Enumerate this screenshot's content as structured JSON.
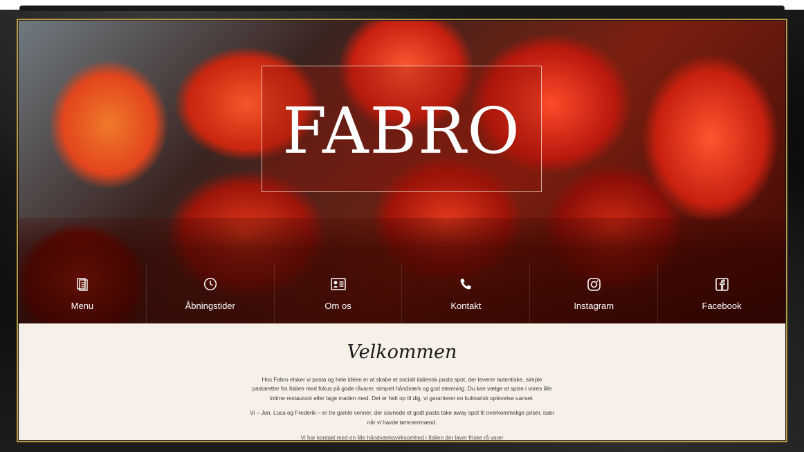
{
  "brand": {
    "name": "FABRO"
  },
  "nav": {
    "items": [
      {
        "label": "Menu",
        "icon": "menu-document-icon"
      },
      {
        "label": "Åbningstider",
        "icon": "clock-icon"
      },
      {
        "label": "Om os",
        "icon": "contact-card-icon"
      },
      {
        "label": "Kontakt",
        "icon": "phone-icon"
      },
      {
        "label": "Instagram",
        "icon": "instagram-icon"
      },
      {
        "label": "Facebook",
        "icon": "facebook-icon"
      }
    ]
  },
  "welcome": {
    "heading": "Velkommen",
    "paragraphs": [
      "Hos Fabro elsker vi pasta og hele idéen er at skabe et socialt italiensk pasta spot, der leverer autentiske, simple pastaretter fra Italien med fokus på gode råvarer, simpelt håndværk og god stemning. Du kan vælge at spise i vores lille intime restaurant eller tage maden med. Det er helt op til dig, vi garanterer en kulinarisk oplevelse uanset.",
      "Vi – Jon, Luca og Frederik – er tre gamle venner, der savnede et godt pasta take away spot til overkommelige priser, især når vi havde tømmermænd.",
      "Vi har kontakt med en lille håndværksvirksomhed i Italien der laver friske rå varer"
    ]
  },
  "colors": {
    "gold_frame": "#b7973f",
    "page_bg": "#f6f0e9",
    "accent_red": "#c51f10"
  }
}
